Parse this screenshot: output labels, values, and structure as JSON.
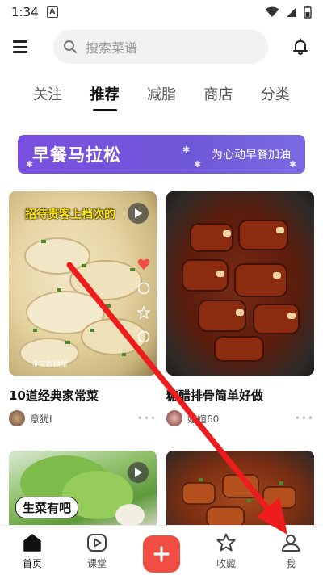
{
  "status_bar": {
    "time": "1:34",
    "badge": "A"
  },
  "header": {
    "search_placeholder": "搜索菜谱"
  },
  "tabs": [
    {
      "label": "关注"
    },
    {
      "label": "推荐",
      "active": true
    },
    {
      "label": "减脂"
    },
    {
      "label": "商店"
    },
    {
      "label": "分类"
    }
  ],
  "banner": {
    "title": "早餐马拉松",
    "subtitle": "为心动早餐加油"
  },
  "feed": [
    {
      "title": "10道经典家常菜",
      "author": "意犹I",
      "overlay": "招待贵客上档次的",
      "watermark": "金宝教做菜"
    },
    {
      "title": "糖醋排骨简单好做",
      "author": "媗媗60"
    },
    {
      "bubble": "生菜有吧"
    },
    {}
  ],
  "bottom_nav": [
    {
      "label": "首页",
      "icon": "home-icon",
      "active": true
    },
    {
      "label": "课堂",
      "icon": "play-square-icon"
    },
    {
      "label": "",
      "icon": "plus-icon"
    },
    {
      "label": "收藏",
      "icon": "star-icon"
    },
    {
      "label": "我",
      "icon": "person-icon"
    }
  ],
  "colors": {
    "accent": "#f04e42",
    "banner": "#7a4fe0",
    "arrow": "#ee1c1c"
  }
}
